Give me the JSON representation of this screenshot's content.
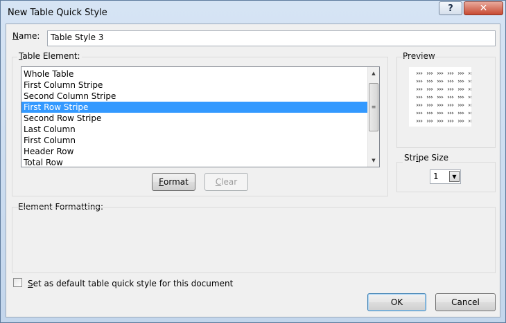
{
  "window": {
    "title": "New Table Quick Style",
    "help_label": "?",
    "close_label": "✕"
  },
  "name_field": {
    "label_key": "N",
    "label_rest": "ame:",
    "value": "Table Style 3"
  },
  "table_element": {
    "label_key": "T",
    "label_rest": "able Element:",
    "items": [
      "Whole Table",
      "First Column Stripe",
      "Second Column Stripe",
      "First Row Stripe",
      "Second Row Stripe",
      "Last Column",
      "First Column",
      "Header Row",
      "Total Row"
    ],
    "selected_index": 3
  },
  "buttons": {
    "format_key": "F",
    "format_rest": "ormat",
    "clear_key": "C",
    "clear_rest": "lear",
    "ok": "OK",
    "cancel": "Cancel"
  },
  "preview": {
    "label": "Preview",
    "rows": 7,
    "cols": 6
  },
  "stripe_size": {
    "label_before": "Str",
    "label_key": "i",
    "label_after": "pe Size",
    "value": "1"
  },
  "element_formatting": {
    "label": "Element Formatting:"
  },
  "default_checkbox": {
    "label_key": "S",
    "label_rest": "et as default table quick style for this document",
    "checked": false
  }
}
